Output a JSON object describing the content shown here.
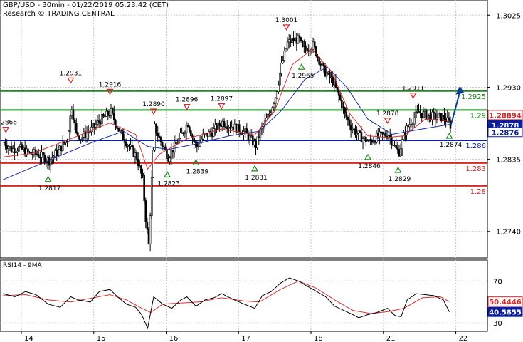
{
  "header": {
    "title": "GBP/USD - 30min - 01/22/2019 05:23:42 (CET)",
    "subtitle": "Research © TRADING CENTRAL"
  },
  "colors": {
    "resistance": "#1a8a1a",
    "support_red": "#d8262a",
    "pivot": "#0a1ea0",
    "ma_fast": "#d83030",
    "ma_slow": "#1a2a9a",
    "candle": "#000000",
    "arrow": "#0d3d8e",
    "price_box_red": "#d8262a",
    "price_box_blue": "#0a1ea0"
  },
  "chart_data": [
    {
      "type": "line",
      "name": "price",
      "ylim": [
        1.2705,
        1.3045
      ],
      "y_ticks": [
        "1.3025",
        "1.2930",
        "1.2835",
        "1.2740"
      ],
      "y_tick_values": [
        1.3025,
        1.293,
        1.2835,
        1.274
      ],
      "x_ticks": [
        "14",
        "15",
        "16",
        "17",
        "18",
        "21",
        "22"
      ],
      "x_tick_index": [
        0,
        48,
        96,
        144,
        192,
        240,
        288
      ],
      "index_range": [
        0,
        300
      ],
      "lines": [
        {
          "role": "resistance",
          "value": 1.2925,
          "label": "1.2925",
          "color": "#1a8a1a"
        },
        {
          "role": "resistance",
          "value": 1.29,
          "label": "1.29",
          "color": "#1a8a1a"
        },
        {
          "role": "pivot",
          "value": 1.286,
          "label": "1.286",
          "color": "#0a1ea0"
        },
        {
          "role": "support",
          "value": 1.283,
          "label": "1.283",
          "color": "#d8262a"
        },
        {
          "role": "support",
          "value": 1.28,
          "label": "1.28",
          "color": "#d8262a"
        }
      ],
      "last_values": [
        {
          "label": "1.28894",
          "value": 1.28894,
          "color": "#d8262a"
        },
        {
          "label": "1.2878",
          "value": 1.2878,
          "color": "#0a1ea0"
        },
        {
          "label": "1.2876",
          "value": 1.2876,
          "color": "#0a1ea0"
        }
      ],
      "highs": [
        {
          "label": "1.2866",
          "i": 2,
          "v": 1.2866
        },
        {
          "label": "1.2931",
          "i": 45,
          "v": 1.2931
        },
        {
          "label": "1.2916",
          "i": 71,
          "v": 1.2916
        },
        {
          "label": "1.2890",
          "i": 100,
          "v": 1.289
        },
        {
          "label": "1.2896",
          "i": 122,
          "v": 1.2896
        },
        {
          "label": "1.2897",
          "i": 145,
          "v": 1.2897
        },
        {
          "label": "1.3001",
          "i": 188,
          "v": 1.3001
        },
        {
          "label": "1.2878",
          "i": 255,
          "v": 1.2878
        },
        {
          "label": "1.2911",
          "i": 272,
          "v": 1.2911
        }
      ],
      "lows": [
        {
          "label": "1.2817",
          "i": 30,
          "v": 1.2817
        },
        {
          "label": "1.2823",
          "i": 109,
          "v": 1.2823
        },
        {
          "label": "1.2839",
          "i": 128,
          "v": 1.2839
        },
        {
          "label": "1.2831",
          "i": 167,
          "v": 1.2831
        },
        {
          "label": "1.2965",
          "i": 198,
          "v": 1.2965
        },
        {
          "label": "1.2846",
          "i": 242,
          "v": 1.2846
        },
        {
          "label": "1.2829",
          "i": 262,
          "v": 1.2829
        },
        {
          "label": "1.2874",
          "i": 296,
          "v": 1.2874
        }
      ],
      "close_path": [
        [
          0,
          1.2858
        ],
        [
          5,
          1.2848
        ],
        [
          10,
          1.285
        ],
        [
          16,
          1.2843
        ],
        [
          22,
          1.2842
        ],
        [
          30,
          1.2833
        ],
        [
          36,
          1.2846
        ],
        [
          42,
          1.2862
        ],
        [
          45,
          1.2905
        ],
        [
          48,
          1.2868
        ],
        [
          52,
          1.2865
        ],
        [
          58,
          1.2874
        ],
        [
          64,
          1.2887
        ],
        [
          71,
          1.2897
        ],
        [
          76,
          1.2874
        ],
        [
          82,
          1.2855
        ],
        [
          88,
          1.2838
        ],
        [
          92,
          1.2808
        ],
        [
          94,
          1.2757
        ],
        [
          96,
          1.2722
        ],
        [
          98,
          1.2808
        ],
        [
          100,
          1.2877
        ],
        [
          104,
          1.2858
        ],
        [
          109,
          1.2838
        ],
        [
          114,
          1.2855
        ],
        [
          118,
          1.2868
        ],
        [
          122,
          1.2883
        ],
        [
          126,
          1.2858
        ],
        [
          128,
          1.2852
        ],
        [
          132,
          1.2865
        ],
        [
          138,
          1.2871
        ],
        [
          145,
          1.2884
        ],
        [
          152,
          1.2878
        ],
        [
          160,
          1.287
        ],
        [
          167,
          1.2853
        ],
        [
          170,
          1.2872
        ],
        [
          176,
          1.2895
        ],
        [
          180,
          1.2918
        ],
        [
          184,
          1.2958
        ],
        [
          188,
          1.2988
        ],
        [
          192,
          1.2993
        ],
        [
          196,
          1.2992
        ],
        [
          198,
          1.298
        ],
        [
          205,
          1.2985
        ],
        [
          212,
          1.2952
        ],
        [
          218,
          1.2938
        ],
        [
          222,
          1.2918
        ],
        [
          226,
          1.2895
        ],
        [
          230,
          1.2878
        ],
        [
          236,
          1.2865
        ],
        [
          242,
          1.2858
        ],
        [
          248,
          1.2865
        ],
        [
          255,
          1.2868
        ],
        [
          260,
          1.2848
        ],
        [
          262,
          1.2845
        ],
        [
          266,
          1.2872
        ],
        [
          270,
          1.2885
        ],
        [
          275,
          1.2897
        ],
        [
          280,
          1.2893
        ],
        [
          286,
          1.2891
        ],
        [
          292,
          1.289
        ],
        [
          296,
          1.288
        ]
      ],
      "ma_fast_path": [
        [
          0,
          1.2838
        ],
        [
          20,
          1.2843
        ],
        [
          45,
          1.2862
        ],
        [
          71,
          1.2883
        ],
        [
          88,
          1.2868
        ],
        [
          96,
          1.2822
        ],
        [
          104,
          1.2842
        ],
        [
          122,
          1.2862
        ],
        [
          145,
          1.2875
        ],
        [
          167,
          1.2867
        ],
        [
          180,
          1.2898
        ],
        [
          192,
          1.296
        ],
        [
          205,
          1.298
        ],
        [
          218,
          1.295
        ],
        [
          230,
          1.2895
        ],
        [
          242,
          1.2866
        ],
        [
          255,
          1.2864
        ],
        [
          266,
          1.2866
        ],
        [
          280,
          1.2888
        ],
        [
          296,
          1.2886
        ]
      ],
      "ma_slow_path": [
        [
          0,
          1.2808
        ],
        [
          30,
          1.2833
        ],
        [
          60,
          1.2858
        ],
        [
          80,
          1.2872
        ],
        [
          96,
          1.2852
        ],
        [
          110,
          1.2848
        ],
        [
          130,
          1.2856
        ],
        [
          150,
          1.2866
        ],
        [
          170,
          1.2872
        ],
        [
          185,
          1.29
        ],
        [
          200,
          1.294
        ],
        [
          215,
          1.2957
        ],
        [
          228,
          1.293
        ],
        [
          242,
          1.2888
        ],
        [
          258,
          1.2868
        ],
        [
          275,
          1.2874
        ],
        [
          296,
          1.2881
        ]
      ],
      "arrow": {
        "from_i": 297,
        "from_v": 1.288,
        "to_i": 303,
        "to_v": 1.2928
      }
    },
    {
      "type": "line",
      "name": "RSI14 - 9MA",
      "ylim": [
        22,
        90
      ],
      "y_ticks": [
        "70",
        "30"
      ],
      "y_tick_values": [
        70,
        30
      ],
      "last_values": [
        {
          "label": "50.4446",
          "value": 50.4446,
          "color": "#d8262a"
        },
        {
          "label": "40.5855",
          "value": 40.5855,
          "color": "#0a1ea0"
        }
      ],
      "rsi_path": [
        [
          0,
          58
        ],
        [
          8,
          55
        ],
        [
          15,
          60
        ],
        [
          22,
          57
        ],
        [
          30,
          48
        ],
        [
          38,
          45
        ],
        [
          45,
          55
        ],
        [
          50,
          52
        ],
        [
          58,
          50
        ],
        [
          64,
          60
        ],
        [
          71,
          62
        ],
        [
          76,
          55
        ],
        [
          82,
          48
        ],
        [
          88,
          45
        ],
        [
          92,
          38
        ],
        [
          96,
          25
        ],
        [
          100,
          55
        ],
        [
          106,
          48
        ],
        [
          112,
          44
        ],
        [
          118,
          52
        ],
        [
          122,
          55
        ],
        [
          128,
          46
        ],
        [
          134,
          52
        ],
        [
          140,
          54
        ],
        [
          145,
          58
        ],
        [
          152,
          53
        ],
        [
          160,
          48
        ],
        [
          167,
          44
        ],
        [
          172,
          56
        ],
        [
          178,
          60
        ],
        [
          184,
          68
        ],
        [
          190,
          73
        ],
        [
          196,
          70
        ],
        [
          202,
          65
        ],
        [
          208,
          60
        ],
        [
          214,
          55
        ],
        [
          220,
          46
        ],
        [
          226,
          42
        ],
        [
          232,
          38
        ],
        [
          236,
          35
        ],
        [
          242,
          38
        ],
        [
          248,
          40
        ],
        [
          255,
          44
        ],
        [
          260,
          37
        ],
        [
          264,
          36
        ],
        [
          268,
          52
        ],
        [
          274,
          58
        ],
        [
          280,
          57
        ],
        [
          286,
          56
        ],
        [
          292,
          52
        ],
        [
          296,
          40.59
        ]
      ],
      "ma_path": [
        [
          0,
          56
        ],
        [
          15,
          57
        ],
        [
          30,
          52
        ],
        [
          45,
          50
        ],
        [
          60,
          54
        ],
        [
          71,
          57
        ],
        [
          82,
          52
        ],
        [
          92,
          44
        ],
        [
          98,
          40
        ],
        [
          106,
          48
        ],
        [
          118,
          49
        ],
        [
          130,
          50
        ],
        [
          145,
          54
        ],
        [
          160,
          51
        ],
        [
          170,
          50
        ],
        [
          184,
          62
        ],
        [
          196,
          70
        ],
        [
          208,
          63
        ],
        [
          220,
          52
        ],
        [
          232,
          42
        ],
        [
          244,
          39
        ],
        [
          256,
          41
        ],
        [
          266,
          44
        ],
        [
          278,
          54
        ],
        [
          290,
          55
        ],
        [
          296,
          50.44
        ]
      ]
    }
  ]
}
